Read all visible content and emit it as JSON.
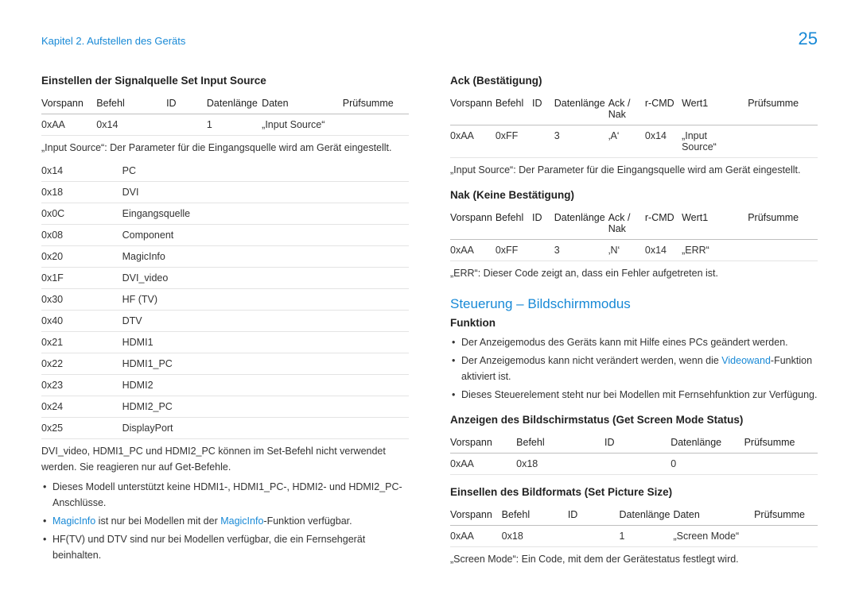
{
  "header": {
    "breadcrumb": "Kapitel 2. Aufstellen des Geräts",
    "page_number": "25"
  },
  "left": {
    "section_title": "Einstellen der Signalquelle  Set Input Source",
    "table1_head": {
      "c1": "Vorspann",
      "c2": "Befehl",
      "c3": "ID",
      "c4": "Datenlänge",
      "c5": "Daten",
      "c6": "Prüfsumme"
    },
    "table1_row": {
      "c1": "0xAA",
      "c2": "0x14",
      "c3": "",
      "c4": "1",
      "c5": "„Input Source“",
      "c6": ""
    },
    "caption1": "„Input Source“: Der Parameter für die Eingangsquelle wird am Gerät eingestellt.",
    "table2": [
      {
        "code": "0x14",
        "label": "PC"
      },
      {
        "code": "0x18",
        "label": "DVI"
      },
      {
        "code": "0x0C",
        "label": "Eingangsquelle"
      },
      {
        "code": "0x08",
        "label": "Component"
      },
      {
        "code": "0x20",
        "label": "MagicInfo"
      },
      {
        "code": "0x1F",
        "label": "DVI_video"
      },
      {
        "code": "0x30",
        "label": "HF (TV)"
      },
      {
        "code": "0x40",
        "label": "DTV"
      },
      {
        "code": "0x21",
        "label": "HDMI1"
      },
      {
        "code": "0x22",
        "label": "HDMI1_PC"
      },
      {
        "code": "0x23",
        "label": "HDMI2"
      },
      {
        "code": "0x24",
        "label": "HDMI2_PC"
      },
      {
        "code": "0x25",
        "label": "DisplayPort"
      }
    ],
    "note2": "DVI_video, HDMI1_PC und HDMI2_PC können im Set-Befehl nicht verwendet werden. Sie reagieren nur auf Get-Befehle.",
    "b1": "Dieses Modell unterstützt keine HDMI1-, HDMI1_PC-, HDMI2- und HDMI2_PC-Anschlüsse.",
    "b2a": "MagicInfo",
    "b2b": " ist nur bei Modellen mit der ",
    "b2c": "MagicInfo",
    "b2d": "-Funktion verfügbar.",
    "b3": "HF(TV) und DTV sind nur bei Modellen verfügbar, die ein Fernsehgerät beinhalten."
  },
  "right": {
    "ack_title": "Ack (Bestätigung)",
    "head7": {
      "c1": "Vorspann",
      "c2": "Befehl",
      "c3": "ID",
      "c4": "Datenlänge",
      "c5": "Ack / Nak",
      "c6": "r-CMD",
      "c7": "Wert1",
      "c8": "Prüfsumme"
    },
    "ack_row": {
      "c1": "0xAA",
      "c2": "0xFF",
      "c3": "",
      "c4": "3",
      "c5": "‚A‘",
      "c6": "0x14",
      "c7": "„Input Source“",
      "c8": ""
    },
    "caption2": "„Input Source“: Der Parameter für die Eingangsquelle wird am Gerät eingestellt.",
    "nak_title": "Nak (Keine Bestätigung)",
    "nak_row": {
      "c1": "0xAA",
      "c2": "0xFF",
      "c3": "",
      "c4": "3",
      "c5": "‚N‘",
      "c6": "0x14",
      "c7": "„ERR“",
      "c8": ""
    },
    "caption3": "„ERR“: Dieser Code zeigt an, dass ein Fehler aufgetreten ist.",
    "control_title": "Steuerung – Bildschirmmodus",
    "func_title": "Funktion",
    "f1": "Der Anzeigemodus des Geräts kann mit Hilfe eines PCs geändert werden.",
    "f2a": "Der Anzeigemodus kann nicht verändert werden, wenn die ",
    "f2b": "Videowand",
    "f2c": "-Funktion aktiviert ist.",
    "f3": "Dieses Steuerelement steht nur bei Modellen mit Fernsehfunktion zur Verfügung.",
    "get_title": "Anzeigen des Bildschirmstatus (Get Screen Mode Status)",
    "head5": {
      "c1": "Vorspann",
      "c2": "Befehl",
      "c3": "ID",
      "c4": "Datenlänge",
      "c5": "Prüfsumme"
    },
    "get_row": {
      "c1": "0xAA",
      "c2": "0x18",
      "c3": "",
      "c4": "0",
      "c5": ""
    },
    "set_title": "Einsellen des Bildformats (Set Picture Size)",
    "head6": {
      "c1": "Vorspann",
      "c2": "Befehl",
      "c3": "ID",
      "c4": "Datenlänge",
      "c5": "Daten",
      "c6": "Prüfsumme"
    },
    "set_row": {
      "c1": "0xAA",
      "c2": "0x18",
      "c3": "",
      "c4": "1",
      "c5": "„Screen Mode“",
      "c6": ""
    },
    "caption4": "„Screen Mode“: Ein Code, mit dem der Gerätestatus festlegt wird."
  }
}
